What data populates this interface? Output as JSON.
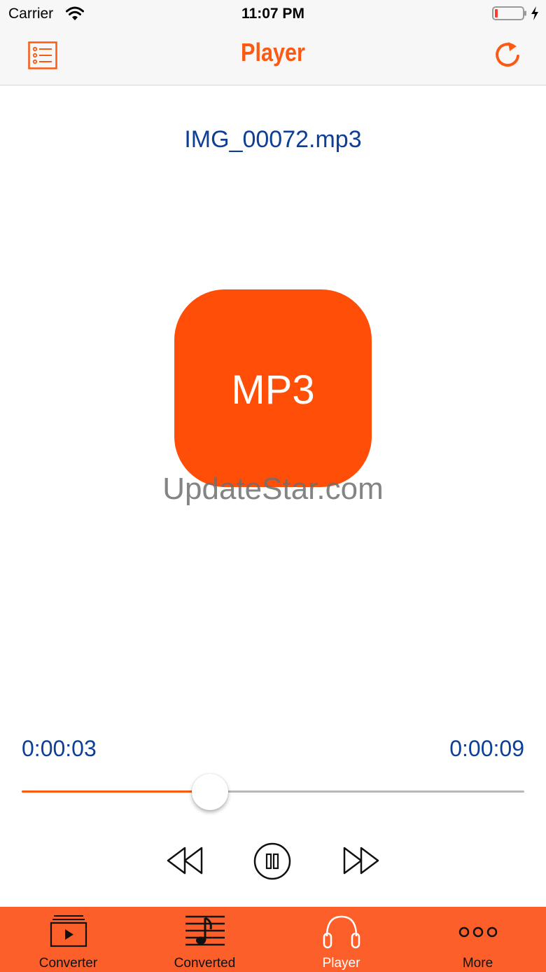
{
  "status_bar": {
    "carrier": "Carrier",
    "time": "11:07 PM"
  },
  "nav": {
    "title": "Player",
    "left_icon": "list-icon",
    "right_icon": "refresh-icon"
  },
  "player": {
    "file_name": "IMG_00072.mp3",
    "artwork_label": "MP3",
    "elapsed": "0:00:03",
    "total": "0:00:09",
    "progress": 0.375
  },
  "watermark": "UpdateStar.com",
  "tabs": [
    {
      "label": "Converter",
      "icon": "video-converter-icon",
      "active": false
    },
    {
      "label": "Converted",
      "icon": "music-sheet-icon",
      "active": false
    },
    {
      "label": "Player",
      "icon": "headphones-icon",
      "active": true
    },
    {
      "label": "More",
      "icon": "more-dots-icon",
      "active": false
    }
  ],
  "colors": {
    "accent": "#fa5a14",
    "artwork": "#ff4e08",
    "tab_bar": "#fc5f2a",
    "text_blue": "#0e3f96"
  }
}
